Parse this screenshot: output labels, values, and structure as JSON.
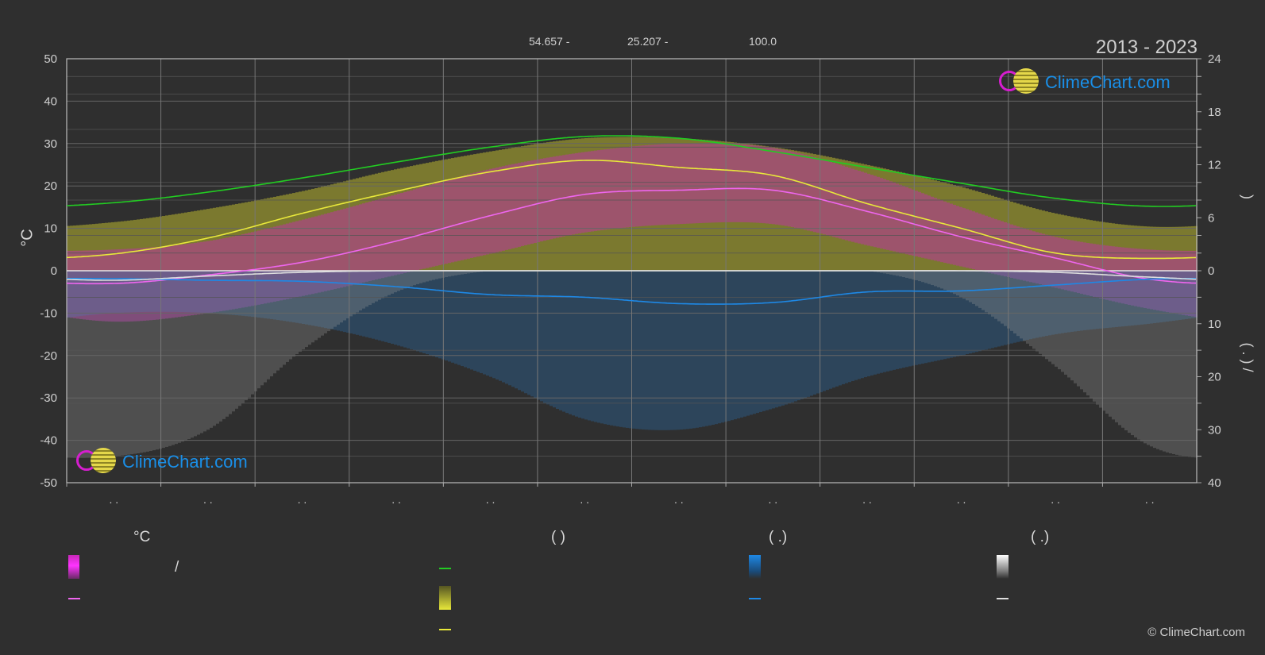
{
  "header": {
    "stat1": "54.657 -",
    "stat2": "25.207 -",
    "stat3": "100.0",
    "period": "2013 - 2023"
  },
  "logo_text": "ClimeChart.com",
  "copyright": "© ClimeChart.com",
  "legend": {
    "col1_head": "°C",
    "col1_slash": "/",
    "col2_head": "(          )",
    "col3_head": "(   .)",
    "col4_head": "(   .)"
  },
  "colors": {
    "background": "#2f2f2f",
    "grid": "#6a6a6a",
    "temp_band": "#c728b9",
    "sun_band": "#b9b62f",
    "rain_band": "#2a6fb0",
    "snow_band": "#9a9a9a",
    "daylight": "#22cc22",
    "sunshine": "#e8e83a",
    "mean_temp": "#ee66ee",
    "precip": "#1e88e5",
    "snow": "#dddddd"
  },
  "icons": {
    "logo": "climechart-logo-icon"
  },
  "chart_data": {
    "type": "line",
    "x_months": [
      0,
      1,
      2,
      3,
      4,
      5,
      6,
      7,
      8,
      9,
      10,
      11
    ],
    "x_tick_labels": [
      ". .",
      ". .",
      ". .",
      ". .",
      ". .",
      ". .",
      ". .",
      ". .",
      ". .",
      ". .",
      ". .",
      ". ."
    ],
    "left_axis": {
      "label": "°C",
      "ylim": [
        -50,
        50
      ],
      "ticks": [
        50,
        40,
        30,
        20,
        10,
        0,
        -10,
        -20,
        -30,
        -40,
        -50
      ]
    },
    "right_axis_top": {
      "label": ")",
      "ylim": [
        0,
        24
      ],
      "ticks": [
        24,
        18,
        12,
        6,
        0
      ]
    },
    "right_axis_bottom": {
      "label": "(  .  )   /",
      "ylim": [
        0,
        40
      ],
      "ticks": [
        10,
        20,
        30,
        40
      ]
    },
    "grid": true,
    "series": [
      {
        "key": "daylight",
        "axis": "hours",
        "values": [
          7.7,
          8.9,
          10.5,
          12.3,
          14.0,
          15.2,
          15.0,
          13.5,
          11.7,
          9.9,
          8.2,
          7.3
        ]
      },
      {
        "key": "sunshine",
        "axis": "hours",
        "values": [
          1.9,
          3.7,
          6.5,
          9.0,
          11.2,
          12.5,
          11.7,
          10.8,
          7.6,
          4.8,
          2.0,
          1.4
        ]
      },
      {
        "key": "mean_temp",
        "axis": "celsius",
        "values": [
          -3.0,
          -1.0,
          2.0,
          7.0,
          13.0,
          18.0,
          19.0,
          19.0,
          14.0,
          8.0,
          3.0,
          -2.0
        ]
      },
      {
        "key": "precip",
        "axis": "mm",
        "values": [
          1.5,
          1.8,
          2.0,
          3.0,
          4.5,
          5.0,
          6.2,
          6.0,
          4.0,
          3.8,
          2.7,
          1.6
        ]
      },
      {
        "key": "snow",
        "axis": "mm",
        "values": [
          1.8,
          1.0,
          0.3,
          0.0,
          0.0,
          0.0,
          0.0,
          0.0,
          0.0,
          0.0,
          0.3,
          1.2
        ]
      }
    ],
    "bands": {
      "temp_max": [
        5,
        7,
        12,
        18,
        24,
        28,
        30,
        29,
        23,
        15,
        8,
        5
      ],
      "temp_min": [
        -12,
        -10,
        -6,
        -1,
        4,
        9,
        11,
        11,
        6,
        1,
        -4,
        -9
      ],
      "sun_max_hours": [
        5.5,
        7.0,
        9.0,
        11.5,
        13.5,
        15.0,
        15.0,
        14.0,
        12.0,
        9.5,
        6.5,
        5.0
      ],
      "rain_depth_mm": [
        8,
        8,
        10,
        14,
        20,
        28,
        30,
        26,
        20,
        16,
        12,
        10
      ],
      "snow_depth_mm": [
        35,
        30,
        15,
        4,
        0,
        0,
        0,
        0,
        0,
        5,
        18,
        33
      ]
    }
  }
}
